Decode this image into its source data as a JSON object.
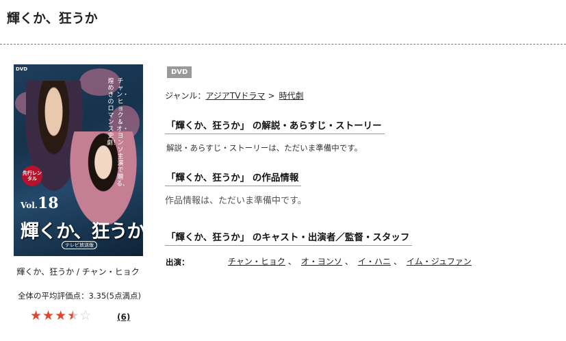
{
  "page": {
    "title": "輝くか、狂うか"
  },
  "poster": {
    "vol_prefix": "Vol.",
    "vol_number": "18",
    "title": "輝くか、狂うか",
    "subtitle": "テレビ放送版",
    "vertical_text_1": "チャン・ヒョク＆オ・ヨンソ主演で贈る、",
    "vertical_text_2": "煌めきのロマンス史劇！",
    "badge": "先行レンタル",
    "format_mark": "DVD"
  },
  "item": {
    "caption": "輝くか、狂うか / チャン・ヒョク",
    "rating_text": "全体の平均評価点：3.35(5点満点)",
    "rating_value": 3.35,
    "rating_max": 5,
    "review_count": "(6)"
  },
  "format_badge": "DVD",
  "genre": {
    "label": "ジャンル：",
    "items": [
      "アジアTVドラマ",
      "時代劇"
    ],
    "separator": ">"
  },
  "sections": {
    "story_heading": "「輝くか、狂うか」 の解説・あらすじ・ストーリー",
    "story_text": "解説・あらすじ・ストーリーは、ただいま準備中です。",
    "info_heading": "「輝くか、狂うか」 の作品情報",
    "info_text": "作品情報は、ただいま準備中です。",
    "cast_heading": "「輝くか、狂うか」 のキャスト・出演者／監督・スタッフ"
  },
  "cast": {
    "label": "出演：",
    "members": [
      "チャン・ヒョク",
      "オ・ヨンソ",
      "イ・ハニ",
      "イム・ジュファン"
    ],
    "separator": "、"
  },
  "colors": {
    "star": "#e0442a",
    "badge_bg": "#999999"
  }
}
